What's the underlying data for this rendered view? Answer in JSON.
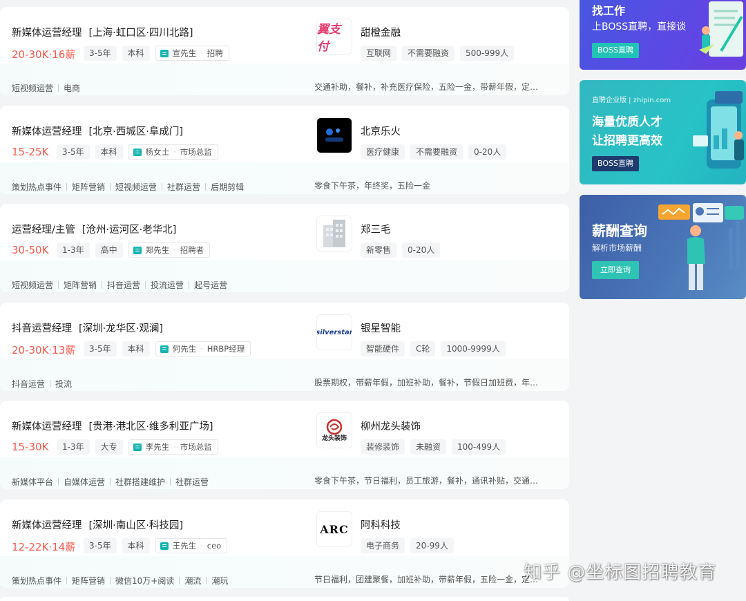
{
  "jobs": [
    {
      "title": "新媒体运营经理",
      "area": "[上海·虹口区·四川北路]",
      "salary": "20-30K·16薪",
      "experience": "3-5年",
      "degree": "本科",
      "recruiter": "宣先生",
      "recruiter_title": "招聘",
      "company": "甜橙金融",
      "company_tags": [
        "互联网",
        "不需要融资",
        "500-999人"
      ],
      "logo_text": "翼支付",
      "skills": [
        "短视频运营",
        "电商"
      ],
      "welfare": "交通补助，餐补，补充医疗保险，五险一金，带薪年假，定期体检"
    },
    {
      "title": "新媒体运营经理",
      "area": "[北京·西城区·阜成门]",
      "salary": "15-25K",
      "experience": "3-5年",
      "degree": "本科",
      "recruiter": "杨女士",
      "recruiter_title": "市场总监",
      "company": "北京乐火",
      "company_tags": [
        "医疗健康",
        "不需要融资",
        "0-20人"
      ],
      "logo_text": "",
      "skills": [
        "策划热点事件",
        "矩阵营销",
        "短视频运营",
        "社群运营",
        "后期剪辑"
      ],
      "welfare": "零食下午茶，年终奖，五险一金"
    },
    {
      "title": "运营经理/主管",
      "area": "[沧州·运河区·老华北]",
      "salary": "30-50K",
      "experience": "1-3年",
      "degree": "高中",
      "recruiter": "郑先生",
      "recruiter_title": "招聘者",
      "company": "郑三毛",
      "company_tags": [
        "新零售",
        "0-20人"
      ],
      "logo_text": "",
      "skills": [
        "短视频运营",
        "矩阵营销",
        "抖音运营",
        "投流运营",
        "起号运营"
      ],
      "welfare": ""
    },
    {
      "title": "抖音运营经理",
      "area": "[深圳·龙华区·观澜]",
      "salary": "20-30K·13薪",
      "experience": "3-5年",
      "degree": "本科",
      "recruiter": "何先生",
      "recruiter_title": "HRBP经理",
      "company": "银星智能",
      "company_tags": [
        "智能硬件",
        "C轮",
        "1000-9999人"
      ],
      "logo_text": "silverstar",
      "skills": [
        "抖音运营",
        "投流"
      ],
      "welfare": "股票期权，带薪年假，加班补助，餐补，节假日加班费，年终奖"
    },
    {
      "title": "新媒体运营经理",
      "area": "[贵港·港北区·维多利亚广场]",
      "salary": "15-30K",
      "experience": "1-3年",
      "degree": "大专",
      "recruiter": "李先生",
      "recruiter_title": "市场总监",
      "company": "柳州龙头装饰",
      "company_tags": [
        "装修装饰",
        "未融资",
        "100-499人"
      ],
      "logo_text": "龙头装饰",
      "skills": [
        "新媒体平台",
        "自媒体运营",
        "社群搭建维护",
        "社群运营"
      ],
      "welfare": "零食下午茶，节日福利，员工旅游，餐补，通讯补贴，交通补助"
    },
    {
      "title": "新媒体运营经理",
      "area": "[深圳·南山区·科技园]",
      "salary": "12-22K·14薪",
      "experience": "3-5年",
      "degree": "本科",
      "recruiter": "王先生",
      "recruiter_title": "ceo",
      "company": "阿科科技",
      "company_tags": [
        "电子商务",
        "20-99人"
      ],
      "logo_text": "ARC",
      "skills": [
        "策划热点事件",
        "矩阵营销",
        "微信10万+阅读",
        "潮流",
        "潮玩"
      ],
      "welfare": "节日福利，团建聚餐，加班补助，带薪年假，五险一金，定期体检"
    }
  ],
  "banners": {
    "b1": {
      "title": "找工作",
      "subtitle": "上BOSS直聘，直接谈",
      "button": "BOSS直聘"
    },
    "b2": {
      "tag": "直聘企业版 | zhipin.com",
      "line1": "海量优质人才",
      "line2": "让招聘更高效",
      "button": "BOSS直聘"
    },
    "b3": {
      "title": "薪酬查询",
      "subtitle": "解析市场薪酬",
      "button": "立即查询"
    }
  },
  "watermark": "知乎 @坐标图招聘教育",
  "colors": {
    "salary": "#fe574a",
    "accent": "#16b4ae"
  }
}
